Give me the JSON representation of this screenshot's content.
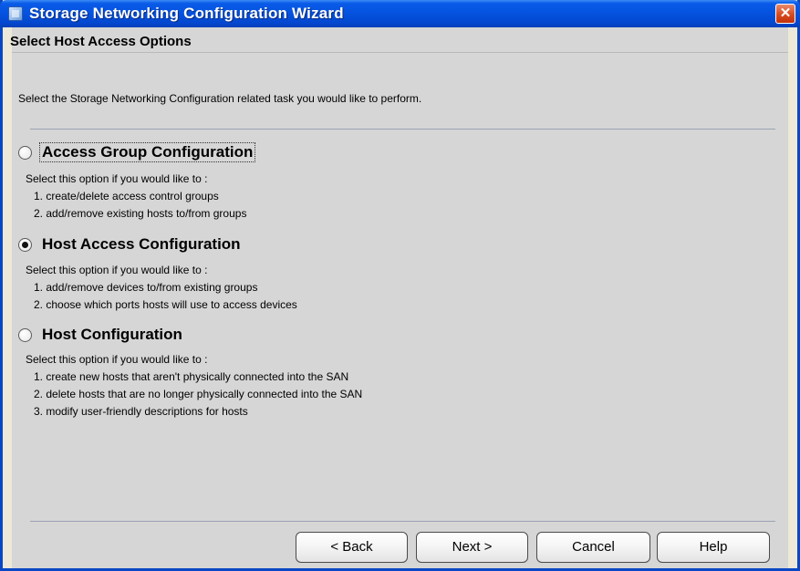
{
  "window": {
    "title": "Storage Networking Configuration Wizard",
    "close_glyph": "✕",
    "icon": "app-icon"
  },
  "header": {
    "section_title": "Select Host Access Options"
  },
  "intro": "Select the Storage Networking Configuration related task you would like to perform.",
  "options": [
    {
      "label": "Access Group Configuration",
      "selected": false,
      "description": "Select this option if you would like to :",
      "items": [
        "1. create/delete access control groups",
        "2. add/remove existing hosts to/from groups"
      ]
    },
    {
      "label": "Host Access Configuration",
      "selected": true,
      "description": "Select this option if you would like to :",
      "items": [
        "1. add/remove devices to/from existing groups",
        "2. choose which ports hosts will use to access devices"
      ]
    },
    {
      "label": "Host Configuration",
      "selected": false,
      "description": "Select this option if you would like to :",
      "items": [
        "1. create new hosts that aren't physically connected into the SAN",
        "2. delete hosts that are no longer physically connected into the SAN",
        "3. modify user-friendly descriptions for hosts"
      ]
    }
  ],
  "buttons": {
    "back": "< Back",
    "next": "Next >",
    "cancel": "Cancel",
    "help": "Help"
  }
}
